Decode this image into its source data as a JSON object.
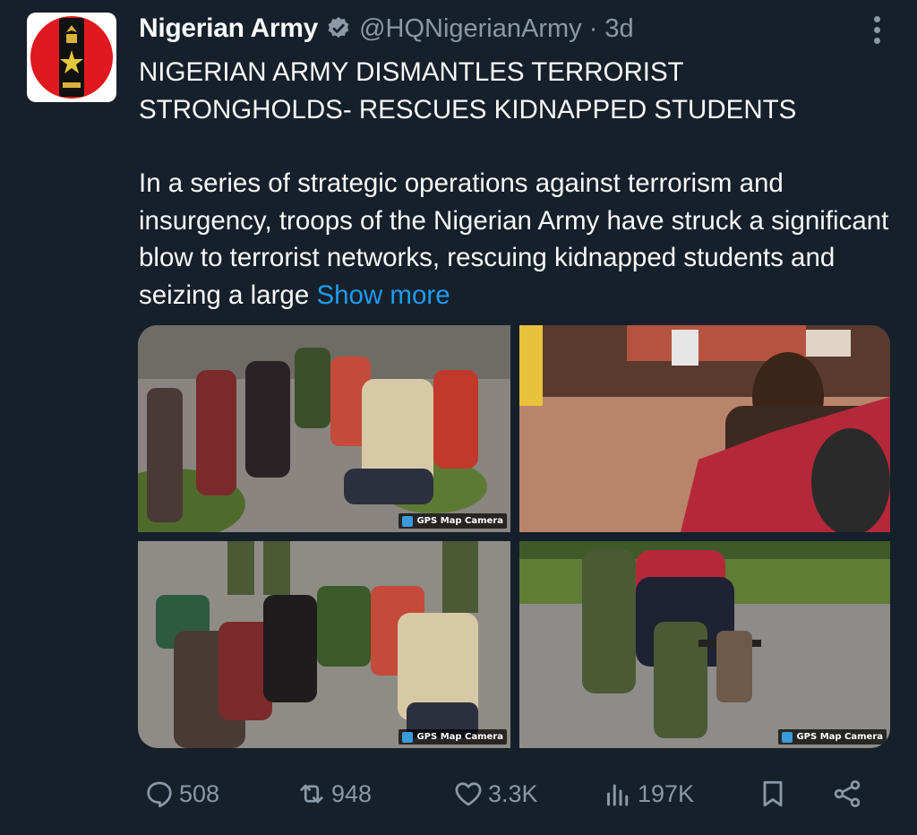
{
  "post": {
    "author_name": "Nigerian Army",
    "handle_time": "@HQNigerianArmy · 3d",
    "headline": "NIGERIAN ARMY DISMANTLES TERRORIST STRONGHOLDS- RESCUES KIDNAPPED STUDENTS",
    "body": "In a series of strategic operations against terrorism and insurgency, troops of the Nigerian Army have struck a significant blow to terrorist networks, rescuing kidnapped students and seizing a large",
    "show_more": "Show more"
  },
  "media": {
    "watermark": "GPS Map Camera"
  },
  "metrics": {
    "replies": "508",
    "reposts": "948",
    "likes": "3.3K",
    "views": "197K"
  },
  "icons": {
    "verified": "verified-badge-icon",
    "more": "more-vertical-icon",
    "reply": "reply-icon",
    "repost": "repost-icon",
    "like": "heart-icon",
    "views": "views-chart-icon",
    "bookmark": "bookmark-icon",
    "share": "share-icon"
  },
  "colors": {
    "background": "#15202b",
    "text": "#f7f9f9",
    "secondary": "#8b98a5",
    "link": "#1d9bf0",
    "avatar_red": "#e0181f"
  }
}
